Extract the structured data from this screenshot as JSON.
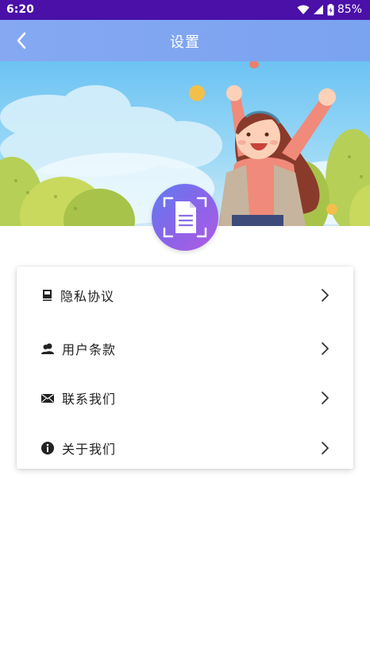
{
  "status_bar": {
    "time": "6:20",
    "battery": "85%"
  },
  "title_bar": {
    "title": "设置"
  },
  "menu": {
    "items": [
      {
        "label": "隐私协议",
        "icon": "book-icon"
      },
      {
        "label": "用户条款",
        "icon": "users-icon"
      },
      {
        "label": "联系我们",
        "icon": "envelope-icon"
      },
      {
        "label": "关于我们",
        "icon": "info-icon"
      }
    ]
  },
  "colors": {
    "status_bar": "#4a10a8",
    "title_bar": "#7ea5f1",
    "avatar_gradient": [
      "#5f7cf0",
      "#b05be0"
    ]
  }
}
